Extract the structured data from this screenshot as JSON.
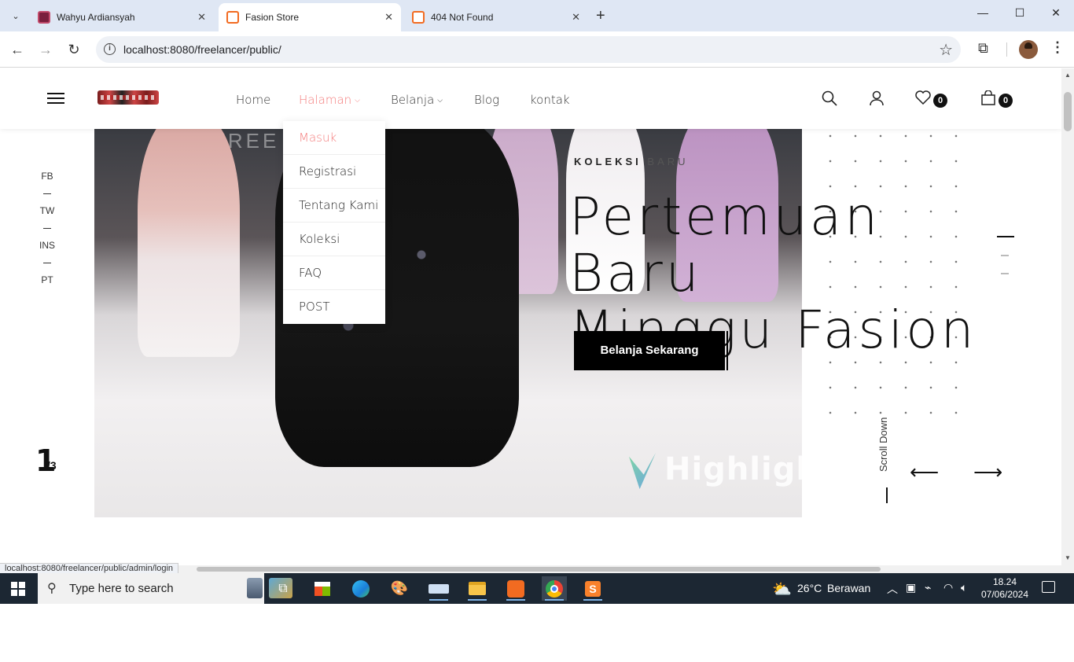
{
  "browser": {
    "tabs": [
      {
        "title": "Wahyu Ardiansyah",
        "active": false
      },
      {
        "title": "Fasion Store",
        "active": true
      },
      {
        "title": "404 Not Found",
        "active": false
      }
    ],
    "url": "localhost:8080/freelancer/public/",
    "status_url": "localhost:8080/freelancer/public/admin/login"
  },
  "site": {
    "nav": [
      {
        "label": "Home",
        "active": false,
        "has_dropdown": false
      },
      {
        "label": "Halaman",
        "active": true,
        "has_dropdown": true
      },
      {
        "label": "Belanja",
        "active": false,
        "has_dropdown": true
      },
      {
        "label": "Blog",
        "active": false,
        "has_dropdown": false
      },
      {
        "label": "kontak",
        "active": false,
        "has_dropdown": false
      }
    ],
    "dropdown": [
      {
        "label": "Masuk",
        "active": true
      },
      {
        "label": "Registrasi",
        "active": false
      },
      {
        "label": "Tentang Kami",
        "active": false
      },
      {
        "label": "Koleksi",
        "active": false
      },
      {
        "label": "FAQ",
        "active": false
      },
      {
        "label": "POST",
        "active": false
      }
    ],
    "wishlist_count": "0",
    "cart_count": "0",
    "social": [
      "FB",
      "TW",
      "INS",
      "PT"
    ],
    "hero": {
      "eyebrow_bold": "KOLEKSI",
      "eyebrow_light": "BARU",
      "headline_line1": "Pertemuan Baru",
      "headline_line2": "Minggu Fasion",
      "cta": "Belanja Sekarang",
      "slide_current": "1",
      "slide_total": "/3",
      "scroll_label": "Scroll Down",
      "watermark": "Highlight",
      "prev_arrow": "⟵",
      "next_arrow": "⟶"
    },
    "colors": {
      "accent": "#f47b7b",
      "primary": "#000000"
    }
  },
  "taskbar": {
    "search_placeholder": "Type here to search",
    "weather_temp": "26°C",
    "weather_desc": "Berawan",
    "time": "18.24",
    "date": "07/06/2024"
  }
}
